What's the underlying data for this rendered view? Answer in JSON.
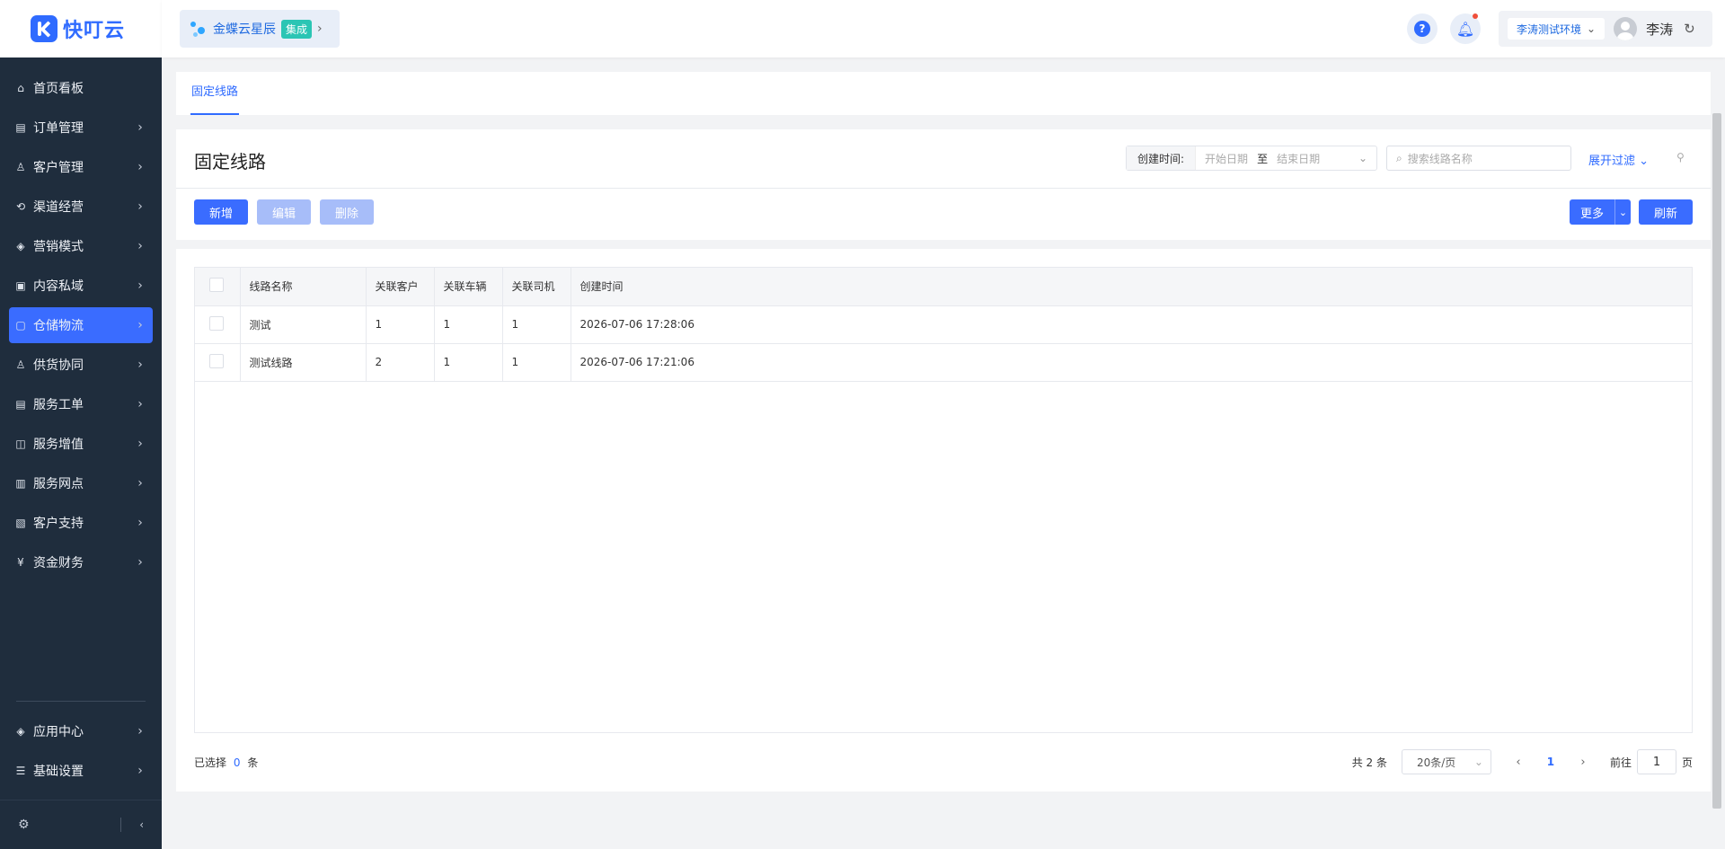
{
  "sidebar": {
    "logo_text": "快叮云",
    "items": [
      {
        "label": "首页看板",
        "icon": "home-icon",
        "glyph": "⌂",
        "arrow": false
      },
      {
        "label": "订单管理",
        "icon": "clipboard-icon",
        "glyph": "▤",
        "arrow": true
      },
      {
        "label": "客户管理",
        "icon": "user-icon",
        "glyph": "♙",
        "arrow": true
      },
      {
        "label": "渠道经营",
        "icon": "channel-icon",
        "glyph": "⟲",
        "arrow": true
      },
      {
        "label": "营销模式",
        "icon": "tag-icon",
        "glyph": "◈",
        "arrow": true
      },
      {
        "label": "内容私域",
        "icon": "image-icon",
        "glyph": "▣",
        "arrow": true
      },
      {
        "label": "仓储物流",
        "icon": "warehouse-icon",
        "glyph": "▢",
        "arrow": true,
        "active": true
      },
      {
        "label": "供货协同",
        "icon": "supplier-icon",
        "glyph": "♙",
        "arrow": true
      },
      {
        "label": "服务工单",
        "icon": "ticket-icon",
        "glyph": "▤",
        "arrow": true
      },
      {
        "label": "服务增值",
        "icon": "bag-icon",
        "glyph": "◫",
        "arrow": true
      },
      {
        "label": "服务网点",
        "icon": "store-icon",
        "glyph": "▥",
        "arrow": true
      },
      {
        "label": "客户支持",
        "icon": "support-icon",
        "glyph": "▧",
        "arrow": true
      },
      {
        "label": "资金财务",
        "icon": "yen-icon",
        "glyph": "¥",
        "arrow": true
      }
    ],
    "bottom_items": [
      {
        "label": "应用中心",
        "icon": "cube-icon",
        "glyph": "◈",
        "arrow": true
      },
      {
        "label": "基础设置",
        "icon": "sliders-icon",
        "glyph": "☰",
        "arrow": true
      }
    ]
  },
  "header": {
    "brand_name": "金蝶云星辰",
    "brand_tag": "集成",
    "help": "?",
    "env": "李涛测试环境",
    "user_name": "李涛"
  },
  "tabs": [
    {
      "label": "固定线路"
    }
  ],
  "page": {
    "title": "固定线路",
    "date_label": "创建时间:",
    "date_start": "开始日期",
    "date_sep": "至",
    "date_end": "结束日期",
    "search_placeholder": "搜索线路名称",
    "expand_filter": "展开过滤"
  },
  "toolbar": {
    "add": "新增",
    "edit": "编辑",
    "delete": "删除",
    "more": "更多",
    "refresh": "刷新"
  },
  "table": {
    "columns": [
      "线路名称",
      "关联客户",
      "关联车辆",
      "关联司机",
      "创建时间"
    ],
    "rows": [
      [
        "测试",
        "1",
        "1",
        "1",
        "2026-07-06 17:28:06"
      ],
      [
        "测试线路",
        "2",
        "1",
        "1",
        "2026-07-06 17:21:06"
      ]
    ]
  },
  "footer": {
    "selected_prefix": "已选择",
    "selected_count": "0",
    "selected_suffix": "条",
    "total": "共 2 条",
    "page_size": "20条/页",
    "current_page": "1",
    "goto_label": "前往",
    "goto_value": "1",
    "goto_suffix": "页"
  },
  "colors": {
    "primary": "#3a6cff",
    "sidebar_bg": "#1f2d3d",
    "disabled_btn": "#a7bdf9",
    "brand_tag": "#2bc5b4"
  }
}
